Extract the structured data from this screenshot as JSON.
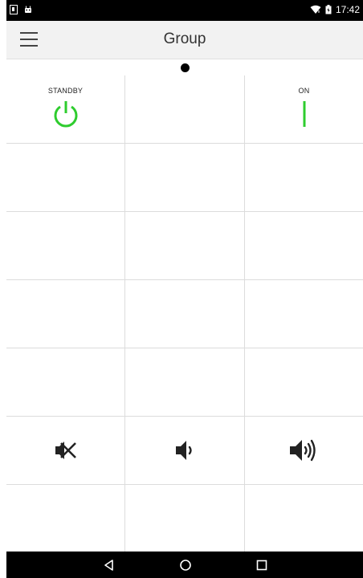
{
  "status_bar": {
    "time": "17:42"
  },
  "app_bar": {
    "title": "Group"
  },
  "grid": {
    "standby_label": "STANDBY",
    "on_label": "ON"
  },
  "colors": {
    "power_green": "#2ecc2e"
  },
  "icons": {
    "standby": "power-icon",
    "on": "on-bar-icon",
    "mute": "mute-icon",
    "volume_down": "volume-down-icon",
    "volume_up": "volume-up-icon"
  }
}
